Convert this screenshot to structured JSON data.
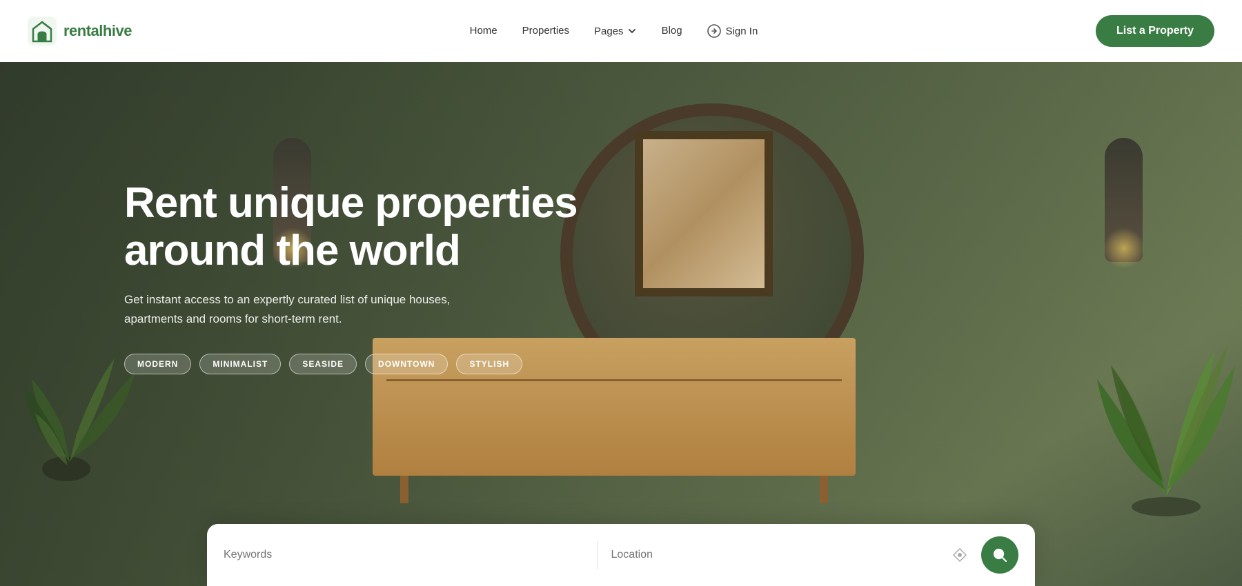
{
  "navbar": {
    "logo_text_part1": "rental",
    "logo_text_part2": "hive",
    "nav_items": [
      {
        "id": "home",
        "label": "Home",
        "has_dropdown": false
      },
      {
        "id": "properties",
        "label": "Properties",
        "has_dropdown": false
      },
      {
        "id": "pages",
        "label": "Pages",
        "has_dropdown": true
      },
      {
        "id": "blog",
        "label": "Blog",
        "has_dropdown": false
      }
    ],
    "signin_label": "Sign In",
    "list_property_label": "List a Property"
  },
  "hero": {
    "title_line1": "Rent unique properties",
    "title_line2": "around the world",
    "subtitle": "Get instant access to an expertly curated list of unique houses, apartments and rooms for short-term rent.",
    "tags": [
      "MODERN",
      "MINIMALIST",
      "SEASIDE",
      "DOWNTOWN",
      "STYLISH"
    ]
  },
  "search_bar": {
    "keywords_placeholder": "Keywords",
    "location_placeholder": "Location"
  },
  "colors": {
    "brand_green": "#3a7d44",
    "dark_text": "#1a1a1a",
    "nav_text": "#333333"
  }
}
